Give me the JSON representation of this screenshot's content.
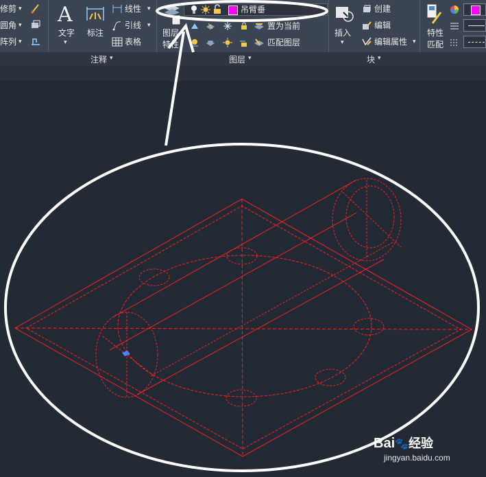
{
  "ribbon": {
    "modify": {
      "trim": "修剪",
      "fillet": "圆角",
      "array": "阵列"
    },
    "annotation": {
      "text": "文字",
      "dimension": "标注",
      "linear": "线性",
      "leader": "引线",
      "table": "表格",
      "title": "注释"
    },
    "layers": {
      "properties_line1": "图层",
      "properties_line2": "特性",
      "set_current": "置为当前",
      "match_layer": "匹配图层",
      "current_layer": "吊臂垂",
      "title": "图层"
    },
    "block": {
      "insert": "插入",
      "create": "创建",
      "edit": "编辑",
      "edit_attributes": "编辑属性",
      "title": "块"
    },
    "properties": {
      "match_line1": "特性",
      "match_line2": "匹配"
    }
  },
  "watermark": {
    "brand": "Bai",
    "brand_suffix": "经验",
    "url": "jingyan.baidu.com"
  },
  "colors": {
    "layer_color": "#ff00ff",
    "drawing": "#ff1f1f",
    "annotation_white": "#ffffff"
  }
}
